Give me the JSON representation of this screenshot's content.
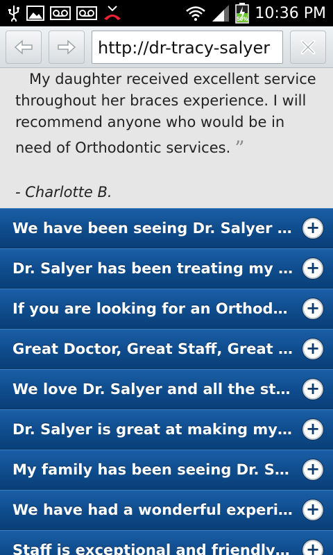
{
  "statusbar": {
    "time": "10:36 PM",
    "battery_percent": "50%",
    "icons": [
      "usb-icon",
      "image-icon",
      "voicemail-icon",
      "voicemail-icon",
      "missed-call-icon",
      "wifi-icon",
      "signal-icon",
      "battery-icon"
    ]
  },
  "browser": {
    "url": "http://dr-tracy-salyer"
  },
  "testimonial": {
    "text_line1": "My daughter received excellent service",
    "text_line2": "throughout her braces experience. I will",
    "text_line3": "recommend anyone who would be in",
    "text_line4": "need of Orthodontic services.",
    "close_quote": "”",
    "author": "- Charlotte B."
  },
  "accordion": {
    "items": [
      {
        "label": "We have been seeing Dr. Salyer for ..."
      },
      {
        "label": "Dr. Salyer has been treating my son..."
      },
      {
        "label": "If you are looking for an Orthodont..."
      },
      {
        "label": "Great Doctor, Great Staff, Great Re..."
      },
      {
        "label": "We love Dr. Salyer and all the staf..."
      },
      {
        "label": "Dr. Salyer is great at making my da..."
      },
      {
        "label": "My family has been seeing Dr. Saly..."
      },
      {
        "label": "We have had a wonderful experienc..."
      },
      {
        "label": "Staff is exceptional and friendly ..."
      }
    ],
    "expand_glyph": "+"
  }
}
